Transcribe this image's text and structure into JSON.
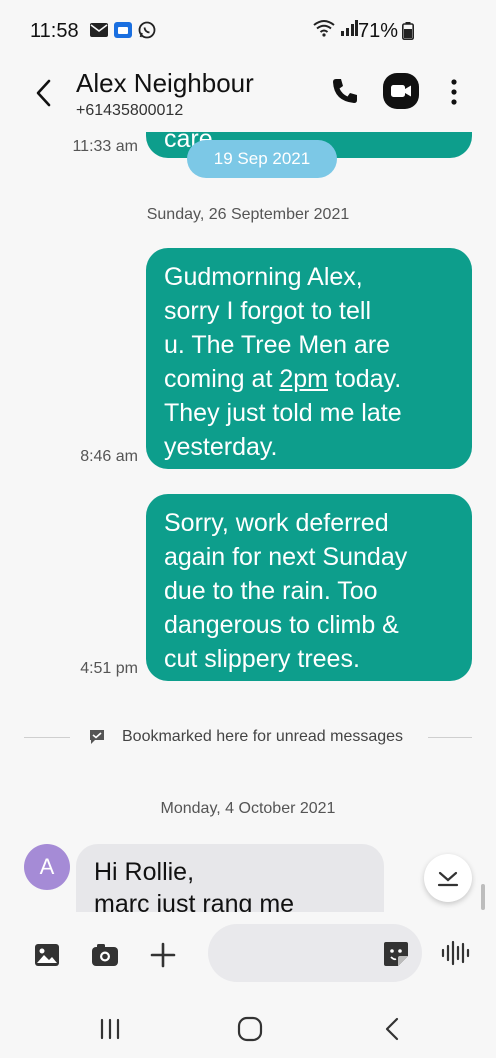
{
  "status_bar": {
    "time": "11:58",
    "battery": "71%"
  },
  "header": {
    "contact_name": "Alex Neighbour",
    "contact_number": "+61435800012"
  },
  "conversation": {
    "previous": {
      "time": "11:33 am",
      "partial_text": "care.",
      "date_pill": "19 Sep 2021"
    },
    "divider_1": "Sunday, 26 September 2021",
    "messages": [
      {
        "time": "8:46 am",
        "lines": [
          "Gudmorning Alex,",
          "sorry I forgot to tell",
          "u. The Tree Men are",
          "coming at 2pm today.",
          "They just told me late",
          "yesterday."
        ]
      },
      {
        "time": "4:51 pm",
        "lines": [
          "Sorry, work deferred",
          "again for next Sunday",
          "due to the rain. Too",
          "dangerous to climb &",
          "cut slippery trees."
        ]
      }
    ],
    "bookmark_text": "Bookmarked here for unread messages",
    "divider_2": "Monday, 4 October 2021",
    "incoming": {
      "avatar_letter": "A",
      "lines": [
        "Hi Rollie,",
        "marc just rang me"
      ]
    }
  },
  "composer": {
    "placeholder": ""
  },
  "colors": {
    "outgoing_bubble": "#0d9e8c",
    "incoming_bubble": "#e7e7ea",
    "date_pill": "#7cc8e6",
    "avatar": "#a58bd6"
  },
  "icons": [
    "mail-icon",
    "folder-icon",
    "whatsapp-icon",
    "wifi-icon",
    "signal-icon",
    "battery-icon",
    "back-arrow-icon",
    "phone-icon",
    "video-call-icon",
    "more-vert-icon",
    "bookmark-icon",
    "chevron-down-icon",
    "image-icon",
    "camera-icon",
    "plus-icon",
    "sticker-icon",
    "voice-icon",
    "recents-icon",
    "home-icon",
    "nav-back-icon"
  ]
}
